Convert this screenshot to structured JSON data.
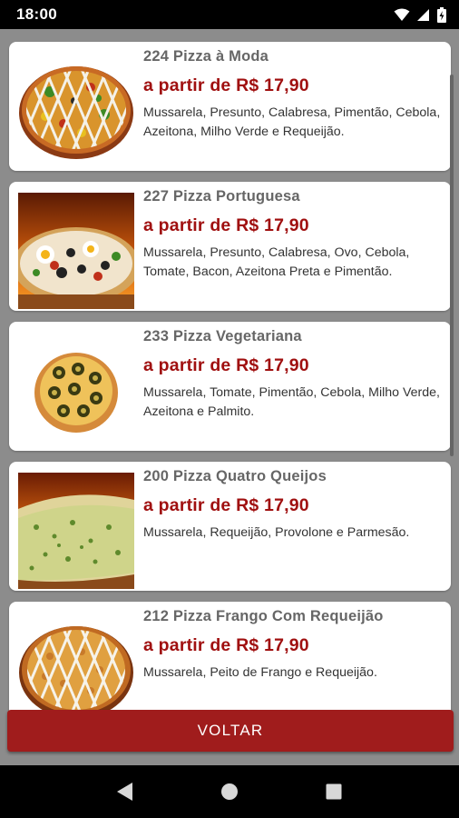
{
  "status_bar": {
    "time": "18:00"
  },
  "products": [
    {
      "title": "224 Pizza à Moda",
      "price": "a partir de R$ 17,90",
      "description": "Mussarela, Presunto, Calabresa, Pimentão, Cebola, Azeitona, Milho Verde e Requeijão."
    },
    {
      "title": "227 Pizza Portuguesa",
      "price": "a partir de R$ 17,90",
      "description": "Mussarela, Presunto, Calabresa, Ovo, Cebola, Tomate, Bacon, Azeitona Preta e Pimentão."
    },
    {
      "title": "233 Pizza Vegetariana",
      "price": "a partir de R$ 17,90",
      "description": "Mussarela, Tomate, Pimentão, Cebola, Milho Verde, Azeitona e Palmito."
    },
    {
      "title": "200 Pizza Quatro Queijos",
      "price": "a partir de R$ 17,90",
      "description": "Mussarela, Requeijão, Provolone e Parmesão."
    },
    {
      "title": "212 Pizza Frango Com Requeijão",
      "price": "a partir de R$ 17,90",
      "description": "Mussarela, Peito de Frango e Requeijão."
    }
  ],
  "back_button": {
    "label": "VOLTAR"
  },
  "colors": {
    "accent": "#a01c1c",
    "price": "#a01010",
    "background": "#8c8c8c"
  },
  "icons": {
    "back": "triangle-back-icon",
    "home": "circle-home-icon",
    "recents": "square-recents-icon"
  }
}
